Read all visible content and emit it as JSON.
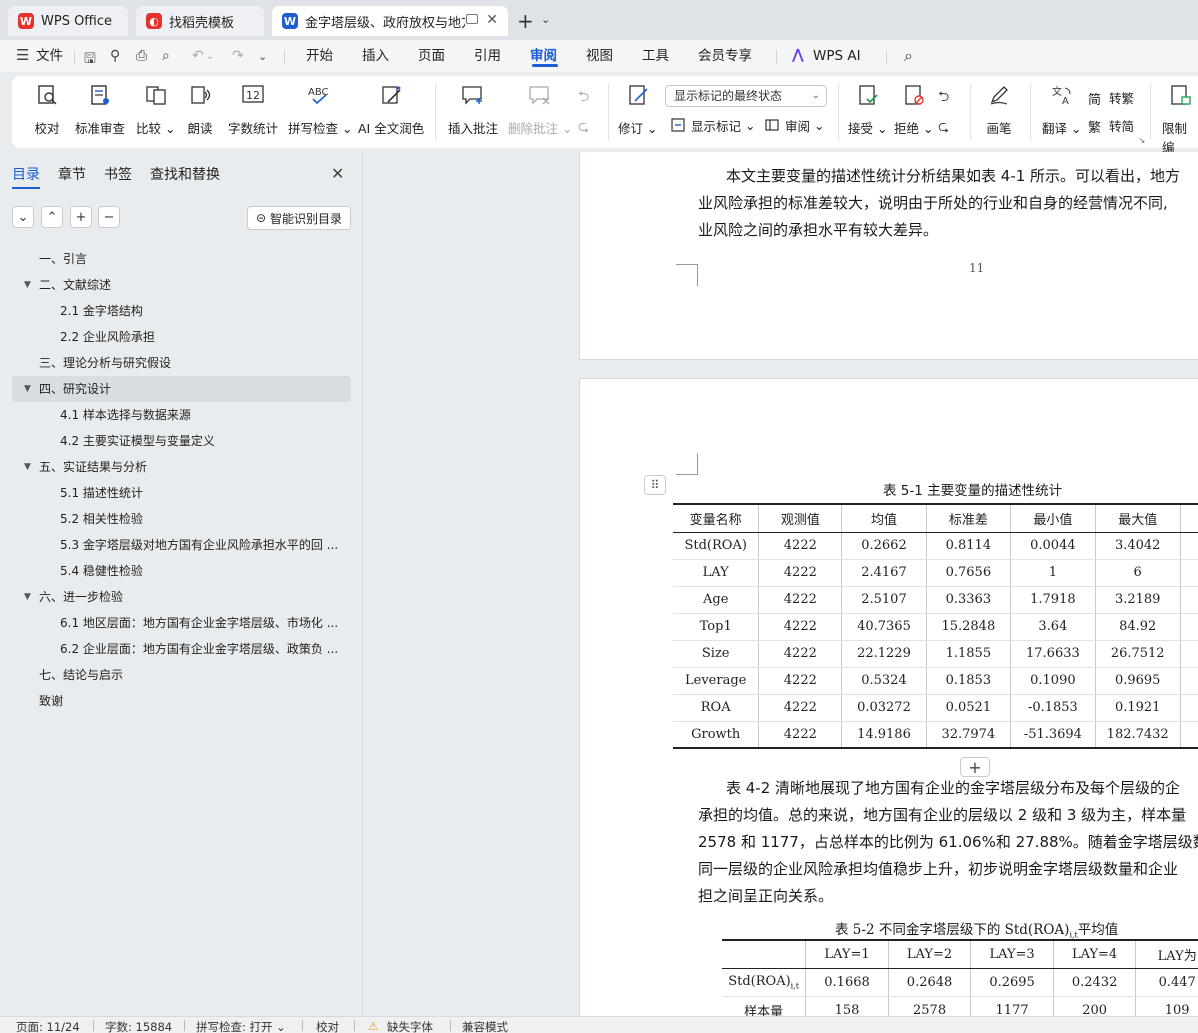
{
  "tabs": {
    "wps_office": "WPS Office",
    "template": "找稻壳模板",
    "document": "金字塔层级、政府放权与地方国"
  },
  "menu": {
    "file": "文件",
    "items": [
      "开始",
      "插入",
      "页面",
      "引用",
      "审阅",
      "视图",
      "工具",
      "会员专享"
    ],
    "active": "审阅",
    "wps_ai": "WPS AI"
  },
  "ribbon": {
    "proofread": "校对",
    "std_review": "标准审查",
    "compare": "比较",
    "read_aloud": "朗读",
    "word_count": "字数统计",
    "spell_check": "拼写检查",
    "ai_polish": "AI 全文润色",
    "insert_comment": "插入批注",
    "delete_comment": "删除批注",
    "revise": "修订",
    "markup_state": "显示标记的最终状态",
    "show_markup": "显示标记",
    "review": "审阅",
    "accept": "接受",
    "reject": "拒绝",
    "pen": "画笔",
    "translate": "翻译",
    "to_traditional": "转繁",
    "to_simplified": "转简",
    "restrict_edit": "限制编"
  },
  "nav": {
    "tabs": [
      "目录",
      "章节",
      "书签",
      "查找和替换"
    ],
    "smart_toc": "智能识别目录",
    "toc": [
      {
        "label": "一、引言",
        "level": 1,
        "caret": false,
        "selected": false
      },
      {
        "label": "二、文献综述",
        "level": 1,
        "caret": true,
        "selected": false
      },
      {
        "label": "2.1 金字塔结构",
        "level": 2,
        "caret": false,
        "selected": false
      },
      {
        "label": "2.2 企业风险承担",
        "level": 2,
        "caret": false,
        "selected": false
      },
      {
        "label": "三、理论分析与研究假设",
        "level": 1,
        "caret": false,
        "selected": false
      },
      {
        "label": "四、研究设计",
        "level": 1,
        "caret": true,
        "selected": true
      },
      {
        "label": "4.1 样本选择与数据来源",
        "level": 2,
        "caret": false,
        "selected": false
      },
      {
        "label": "4.2 主要实证模型与变量定义",
        "level": 2,
        "caret": false,
        "selected": false
      },
      {
        "label": "五、实证结果与分析",
        "level": 1,
        "caret": true,
        "selected": false
      },
      {
        "label": "5.1 描述性统计",
        "level": 2,
        "caret": false,
        "selected": false
      },
      {
        "label": "5.2 相关性检验",
        "level": 2,
        "caret": false,
        "selected": false
      },
      {
        "label": "5.3 金字塔层级对地方国有企业风险承担水平的回 ...",
        "level": 2,
        "caret": false,
        "selected": false
      },
      {
        "label": "5.4 稳健性检验",
        "level": 2,
        "caret": false,
        "selected": false
      },
      {
        "label": "六、进一步检验",
        "level": 1,
        "caret": true,
        "selected": false
      },
      {
        "label": "6.1 地区层面：地方国有企业金字塔层级、市场化 ...",
        "level": 2,
        "caret": false,
        "selected": false
      },
      {
        "label": "6.2 企业层面：地方国有企业金字塔层级、政策负 ...",
        "level": 2,
        "caret": false,
        "selected": false
      },
      {
        "label": "七、结论与启示",
        "level": 1,
        "caret": false,
        "selected": false
      },
      {
        "label": "致谢",
        "level": 1,
        "caret": false,
        "selected": false
      }
    ]
  },
  "doc": {
    "para_top": [
      "本文主要变量的描述性统计分析结果如表 4-1 所示。可以看出，地方",
      "业风险承担的标准差较大，说明由于所处的行业和自身的经营情况不同,",
      "业风险之间的承担水平有较大差异。"
    ],
    "page_number": "11",
    "table1": {
      "caption": "表 5-1 主要变量的描述性统计",
      "headers": [
        "变量名称",
        "观测值",
        "均值",
        "标准差",
        "最小值",
        "最大值"
      ],
      "rows": [
        [
          "Std(ROA)",
          "4222",
          "0.2662",
          "0.8114",
          "0.0044",
          "3.4042"
        ],
        [
          "LAY",
          "4222",
          "2.4167",
          "0.7656",
          "1",
          "6"
        ],
        [
          "Age",
          "4222",
          "2.5107",
          "0.3363",
          "1.7918",
          "3.2189"
        ],
        [
          "Top1",
          "4222",
          "40.7365",
          "15.2848",
          "3.64",
          "84.92"
        ],
        [
          "Size",
          "4222",
          "22.1229",
          "1.1855",
          "17.6633",
          "26.7512"
        ],
        [
          "Leverage",
          "4222",
          "0.5324",
          "0.1853",
          "0.1090",
          "0.9695"
        ],
        [
          "ROA",
          "4222",
          "0.03272",
          "0.0521",
          "-0.1853",
          "0.1921"
        ],
        [
          "Growth",
          "4222",
          "14.9186",
          "32.7974",
          "-51.3694",
          "182.7432"
        ]
      ]
    },
    "para_mid": [
      "表 4-2 清晰地展现了地方国有企业的金字塔层级分布及每个层级的企",
      "承担的均值。总的来说，地方国有企业的层级以 2 级和 3 级为主，样本量",
      "2578 和 1177，占总样本的比例为 61.06%和 27.88%。随着金字塔层级数",
      "同一层级的企业风险承担均值稳步上升，初步说明金字塔层级数量和企业",
      "担之间呈正向关系。"
    ],
    "table2": {
      "caption_pre": "表 5-2  不同金字塔层级下的 Std(ROA)",
      "caption_sub": "i,t",
      "caption_post": "平均值",
      "headers": [
        "",
        "LAY=1",
        "LAY=2",
        "LAY=3",
        "LAY=4",
        "LAY为"
      ],
      "row1_label": "Std(ROA)",
      "row1_sub": "i,t",
      "row1": [
        "0.1668",
        "0.2648",
        "0.2695",
        "0.2432",
        "0.447"
      ],
      "row2_label": "样本量",
      "row2": [
        "158",
        "2578",
        "1177",
        "200",
        "109"
      ]
    }
  },
  "status": {
    "page": "页面: 11/24",
    "words": "字数: 15884",
    "spell": "拼写检查: 打开",
    "proof": "校对",
    "missing_font": "缺失字体",
    "compat": "兼容模式"
  },
  "colors": {
    "accent": "#1d5dd6",
    "wps_red": "#e5322d"
  }
}
